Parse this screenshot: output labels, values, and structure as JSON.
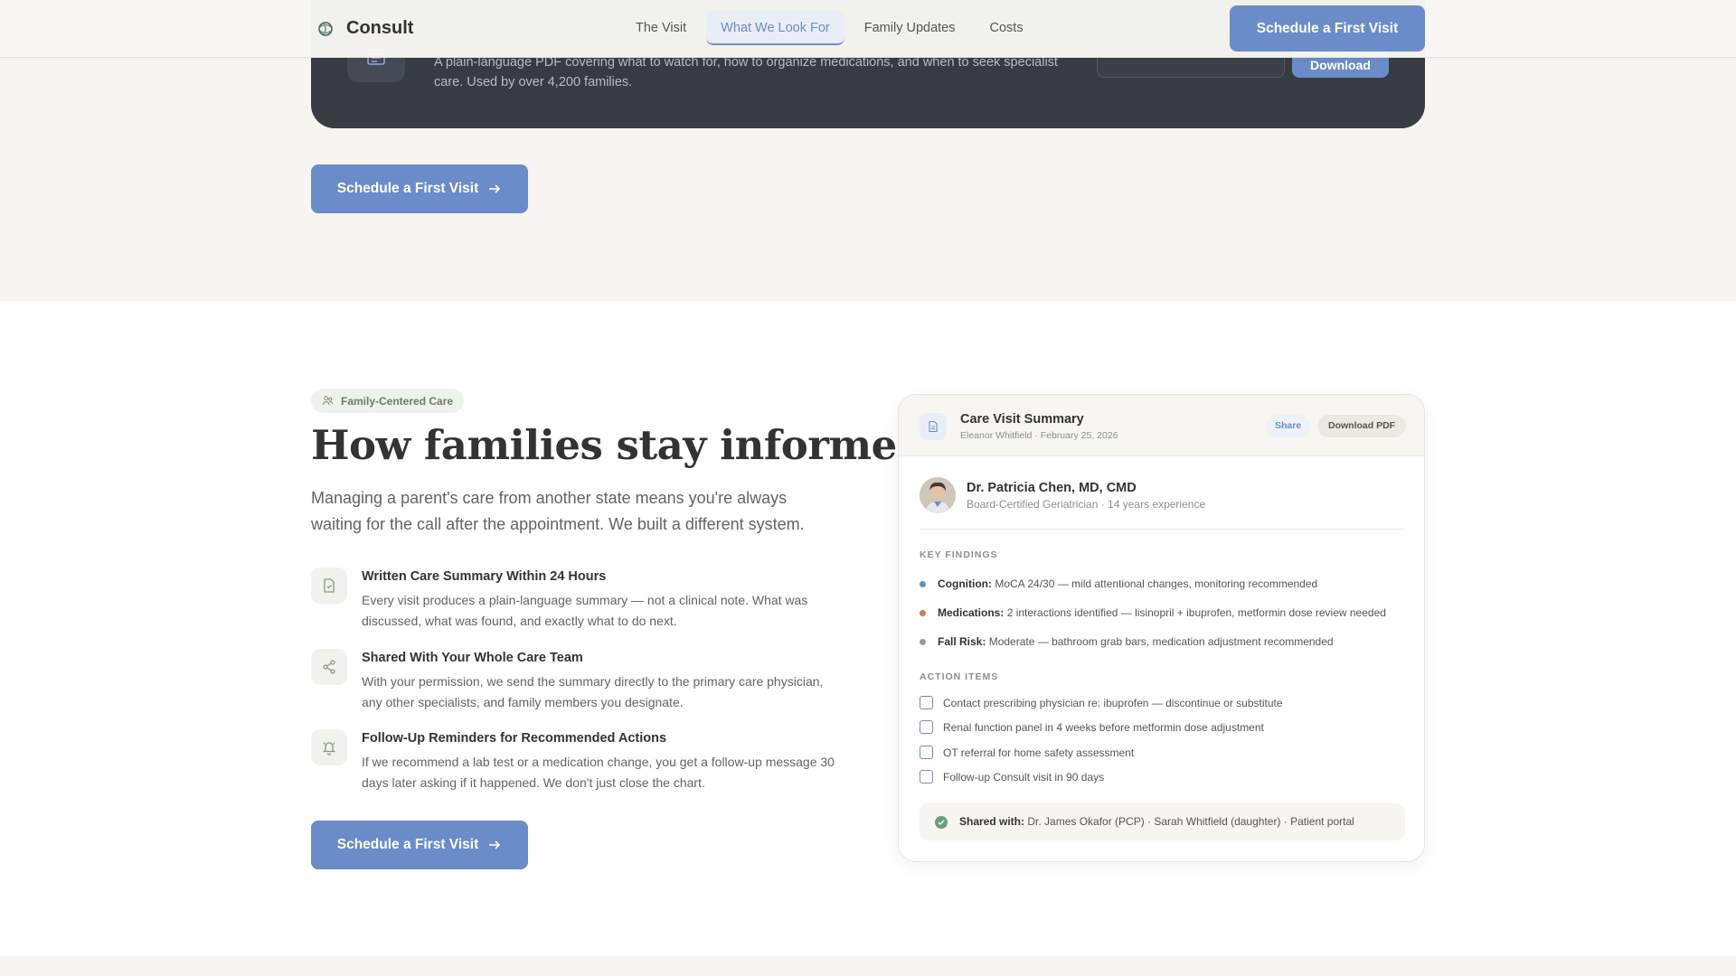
{
  "nav": {
    "brand": "Consult",
    "links": [
      "The Visit",
      "What We Look For",
      "Family Updates",
      "Costs"
    ],
    "active_link": "What We Look For",
    "cta": "Schedule a First Visit"
  },
  "guide_banner": {
    "description": "A plain-language PDF covering what to watch for, how to organize medications, and when to seek specialist care. Used by over 4,200 families.",
    "download_label": "Download"
  },
  "top_cta": "Schedule a First Visit",
  "section": {
    "pill": "Family-Centered Care",
    "headline": "How families stay informed",
    "lead": "Managing a parent's care from another state means you're always waiting for the call after the appointment. We built a different system.",
    "features": [
      {
        "icon": "document-check-icon",
        "title": "Written Care Summary Within 24 Hours",
        "desc": "Every visit produces a plain-language summary — not a clinical note. What was discussed, what was found, and exactly what to do next."
      },
      {
        "icon": "share-icon",
        "title": "Shared With Your Whole Care Team",
        "desc": "With your permission, we send the summary directly to the primary care physician, any other specialists, and family members you designate."
      },
      {
        "icon": "bell-icon",
        "title": "Follow-Up Reminders for Recommended Actions",
        "desc": "If we recommend a lab test or a medication change, you get a follow-up message 30 days later asking if it happened. We don't just close the chart."
      }
    ],
    "cta": "Schedule a First Visit"
  },
  "summary_card": {
    "title": "Care Visit Summary",
    "subtitle": "Eleanor Whitfield · February 25, 2026",
    "share_label": "Share",
    "download_label": "Download PDF",
    "doctor_name": "Dr. Patricia Chen, MD, CMD",
    "doctor_sub": "Board-Certified Geriatrician · 14 years experience",
    "findings_label": "KEY FINDINGS",
    "findings": [
      {
        "label": "Cognition:",
        "text": "MoCA 24/30 — mild attentional changes, monitoring recommended",
        "color": "#6a8cc8"
      },
      {
        "label": "Medications:",
        "text": "2 interactions identified — lisinopril + ibuprofen, metformin dose review needed",
        "color": "#c97a63"
      },
      {
        "label": "Fall Risk:",
        "text": "Moderate — bathroom grab bars, medication adjustment recommended",
        "color": "#9a9a9a"
      }
    ],
    "actions_label": "ACTION ITEMS",
    "actions": [
      "Contact prescribing physician re: ibuprofen — discontinue or substitute",
      "Renal function panel in 4 weeks before metformin dose adjustment",
      "OT referral for home safety assessment",
      "Follow-up Consult visit in 90 days"
    ],
    "shared_label": "Shared with:",
    "shared_text": "Dr. James Okafor (PCP) · Sarah Whitfield (daughter) · Patient portal"
  },
  "colors": {
    "accent": "#6a8cc8",
    "dark_card": "#383b42",
    "band": "#f6f5f1"
  }
}
